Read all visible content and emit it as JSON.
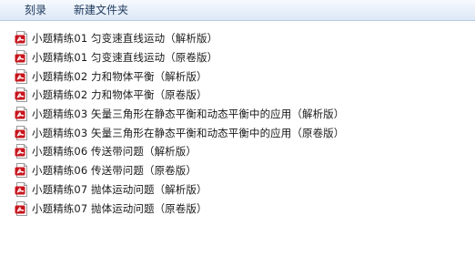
{
  "toolbar": {
    "burn_label": "刻录",
    "new_folder_label": "新建文件夹"
  },
  "files": [
    {
      "name": "小题精练01 匀变速直线运动（解析版）",
      "icon": "pdf-icon"
    },
    {
      "name": "小题精练01 匀变速直线运动（原卷版）",
      "icon": "pdf-icon"
    },
    {
      "name": "小题精练02 力和物体平衡（解析版）",
      "icon": "pdf-icon"
    },
    {
      "name": "小题精练02 力和物体平衡（原卷版）",
      "icon": "pdf-icon"
    },
    {
      "name": "小题精练03 矢量三角形在静态平衡和动态平衡中的应用（解析版）",
      "icon": "pdf-icon"
    },
    {
      "name": "小题精练03 矢量三角形在静态平衡和动态平衡中的应用（原卷版）",
      "icon": "pdf-icon"
    },
    {
      "name": "小题精练06 传送带问题（解析版）",
      "icon": "pdf-icon"
    },
    {
      "name": "小题精练06 传送带问题（原卷版）",
      "icon": "pdf-icon"
    },
    {
      "name": "小题精练07 抛体运动问题（解析版）",
      "icon": "pdf-icon"
    },
    {
      "name": "小题精练07 抛体运动问题（原卷版）",
      "icon": "pdf-icon"
    }
  ],
  "colors": {
    "pdf_red": "#c8151d",
    "toolbar_text": "#1e395b"
  }
}
